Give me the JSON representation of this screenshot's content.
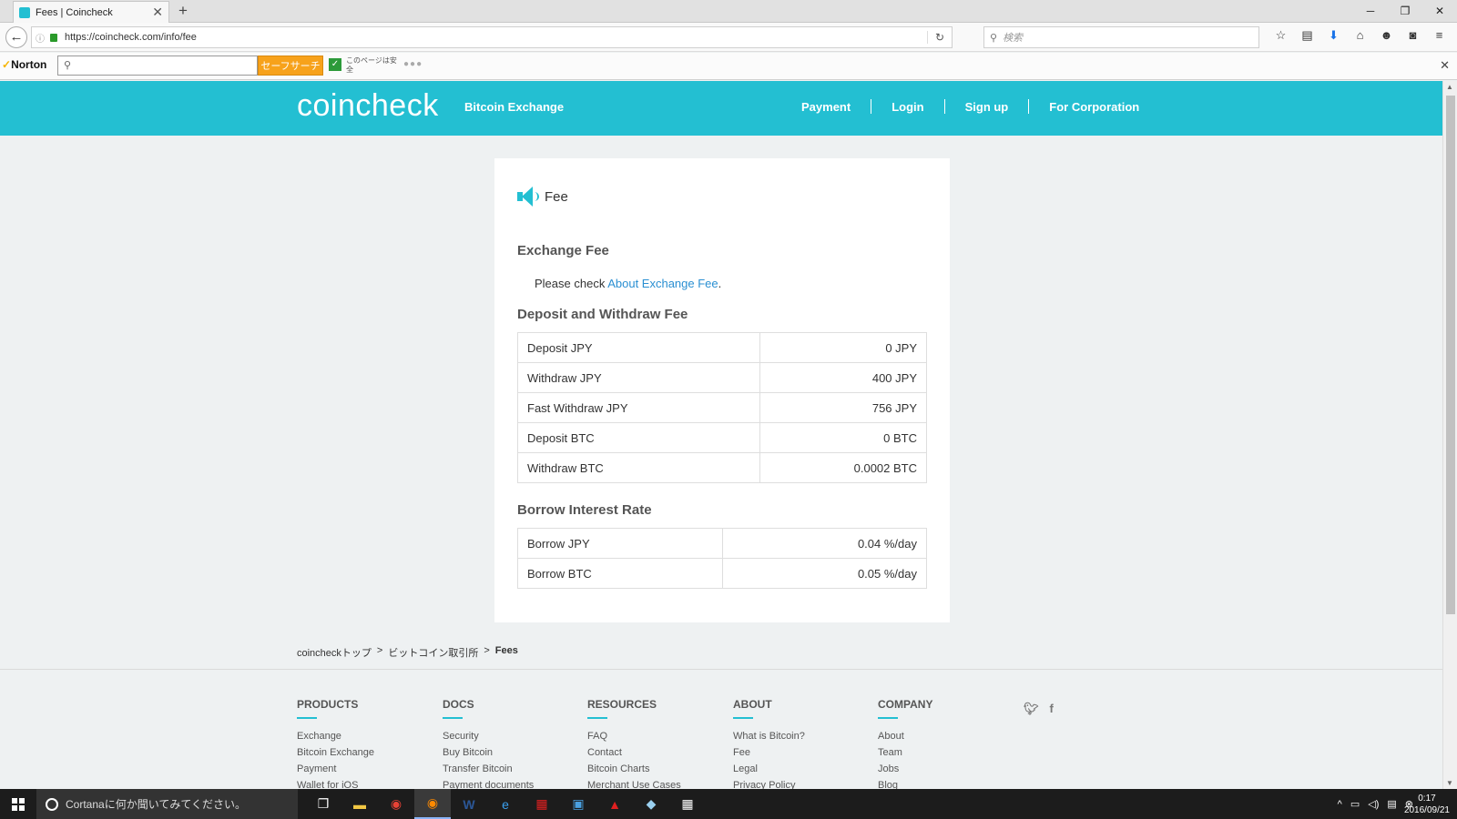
{
  "browser": {
    "tab_title": "Fees | Coincheck",
    "url": "https://coincheck.com/info/fee",
    "search_placeholder": "検索"
  },
  "norton": {
    "logo": "Norton",
    "search_button": "セーフサーチ",
    "safe_text": "このページは安全"
  },
  "site": {
    "logo": "coincheck",
    "tagline": "Bitcoin Exchange",
    "nav": [
      "Payment",
      "Login",
      "Sign up",
      "For Corporation"
    ]
  },
  "card": {
    "title": "Fee",
    "exchange_fee": {
      "heading": "Exchange Fee",
      "text_before": "Please check ",
      "link": "About Exchange Fee",
      "text_after": "."
    },
    "deposit_withdraw": {
      "heading": "Deposit and Withdraw Fee",
      "rows": [
        {
          "label": "Deposit JPY",
          "value": "0 JPY"
        },
        {
          "label": "Withdraw JPY",
          "value": "400 JPY"
        },
        {
          "label": "Fast Withdraw JPY",
          "value": "756 JPY"
        },
        {
          "label": "Deposit BTC",
          "value": "0 BTC"
        },
        {
          "label": "Withdraw BTC",
          "value": "0.0002 BTC"
        }
      ]
    },
    "borrow": {
      "heading": "Borrow Interest Rate",
      "rows": [
        {
          "label": "Borrow JPY",
          "value": "0.04 %/day"
        },
        {
          "label": "Borrow BTC",
          "value": "0.05 %/day"
        }
      ]
    }
  },
  "breadcrumb": {
    "items": [
      "coincheckトップ",
      ">",
      "ビットコイン取引所",
      ">",
      "Fees"
    ]
  },
  "footer": {
    "columns": [
      {
        "heading": "PRODUCTS",
        "items": [
          "Exchange",
          "Bitcoin Exchange",
          "Payment",
          "Wallet for iOS"
        ]
      },
      {
        "heading": "DOCS",
        "items": [
          "Security",
          "Buy Bitcoin",
          "Transfer Bitcoin",
          "Payment documents"
        ]
      },
      {
        "heading": "RESOURCES",
        "items": [
          "FAQ",
          "Contact",
          "Bitcoin Charts",
          "Merchant Use Cases"
        ]
      },
      {
        "heading": "ABOUT",
        "items": [
          "What is Bitcoin?",
          "Fee",
          "Legal",
          "Privacy Policy"
        ]
      },
      {
        "heading": "COMPANY",
        "items": [
          "About",
          "Team",
          "Jobs",
          "Blog"
        ]
      }
    ]
  },
  "taskbar": {
    "cortana": "Cortanaに何か聞いてみてください。",
    "time": "0:17",
    "date": "2016/09/21"
  },
  "colors": {
    "brand": "#23bfd2",
    "link": "#2a8fd2",
    "norton_button": "#f7a21b"
  }
}
